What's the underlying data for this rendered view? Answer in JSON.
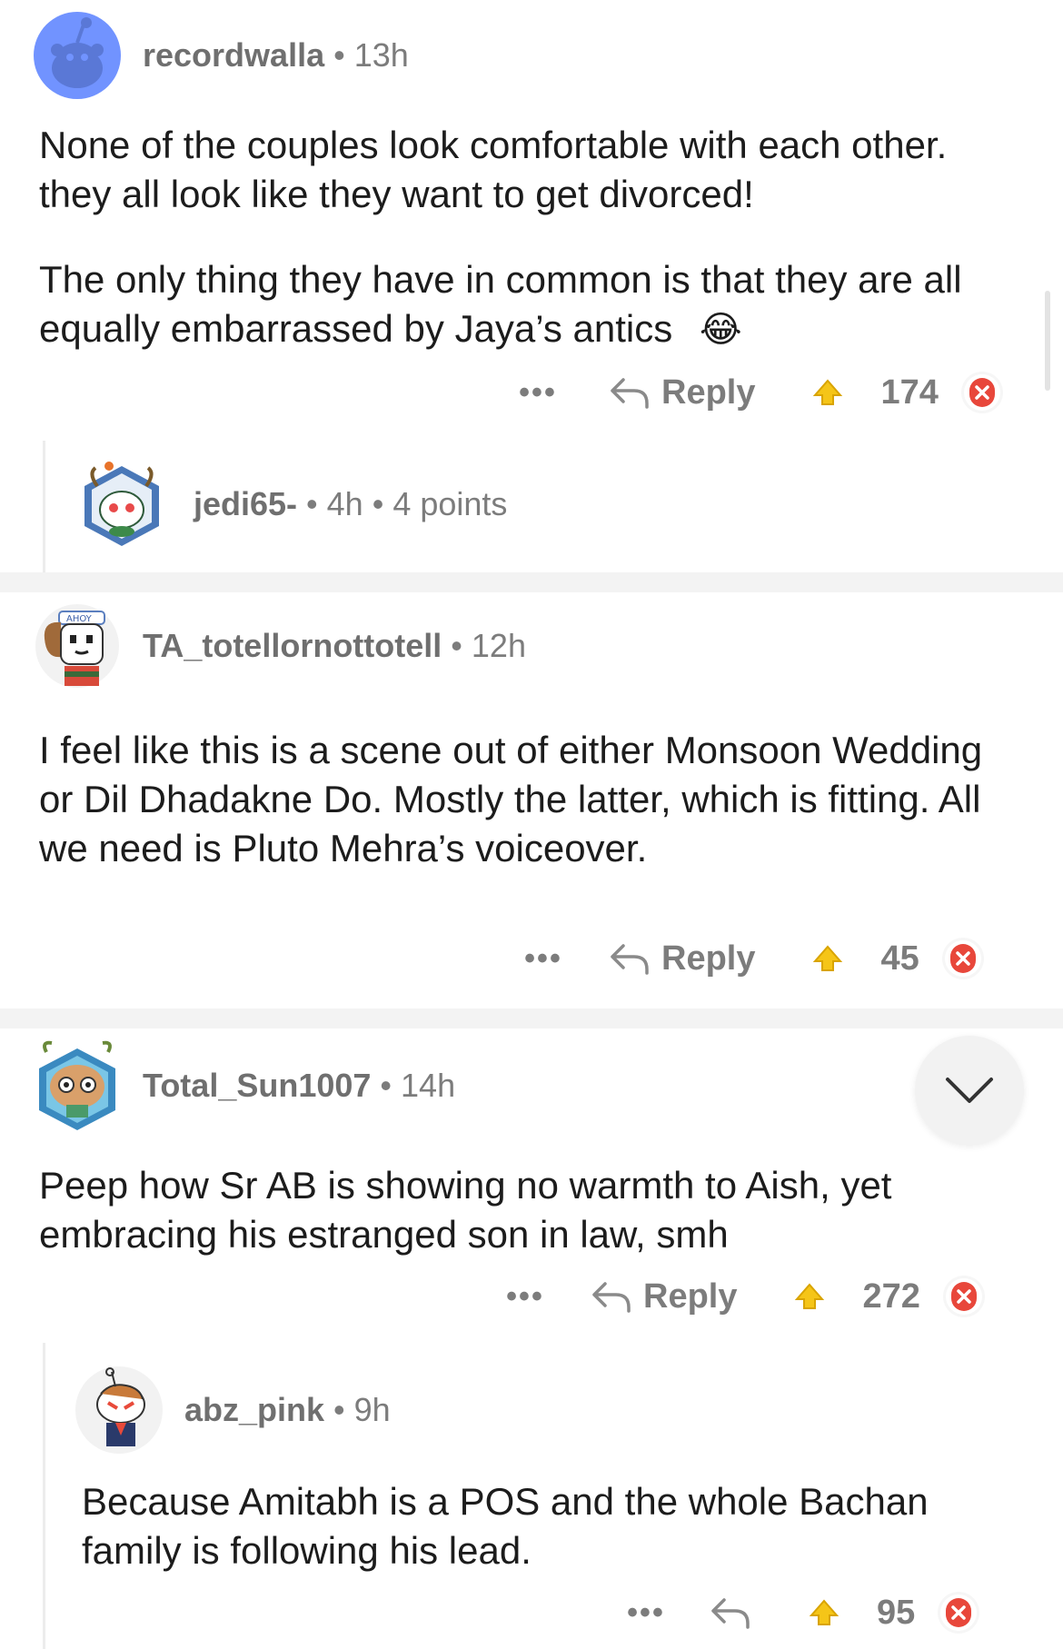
{
  "comments": [
    {
      "username": "recordwalla",
      "age": "13h",
      "paragraphs": [
        "None of the couples look comfortable with each other. they all look like they want to get divorced!",
        "The only thing they have in common is that they are all equally embarrassed by Jaya’s antics"
      ],
      "emoji": "😂",
      "more": "•••",
      "reply_label": "Reply",
      "score": "174"
    },
    {
      "username": "jedi65-",
      "age": "4h",
      "points": "4 points"
    },
    {
      "username": "TA_totellornottotell",
      "age": "12h",
      "text": "I feel like this is a scene out of either Monsoon Wedding or Dil Dhadakne Do. Mostly the latter, which is fitting. All we need is Pluto Mehra’s voiceover.",
      "more": "•••",
      "reply_label": "Reply",
      "score": "45"
    },
    {
      "username": "Total_Sun1007",
      "age": "14h",
      "text": "Peep how Sr AB is showing no warmth to Aish, yet embracing his estranged son in law, smh",
      "more": "•••",
      "reply_label": "Reply",
      "score": "272"
    },
    {
      "username": "abz_pink",
      "age": "9h",
      "text": "Because Amitabh is a POS and the whole Bachan family is following his lead.",
      "more": "•••",
      "score": "95"
    }
  ],
  "separator": "•",
  "icons": {
    "upvote": "upvote-icon",
    "downvote": "downvote-icon",
    "reply": "reply-arrow-icon",
    "collapse": "chevron-down-icon"
  },
  "colors": {
    "upvote": "#f5c518",
    "downvote": "#e8473b",
    "muted": "#7c7c7c",
    "avatar_blue": "#7193ff"
  }
}
